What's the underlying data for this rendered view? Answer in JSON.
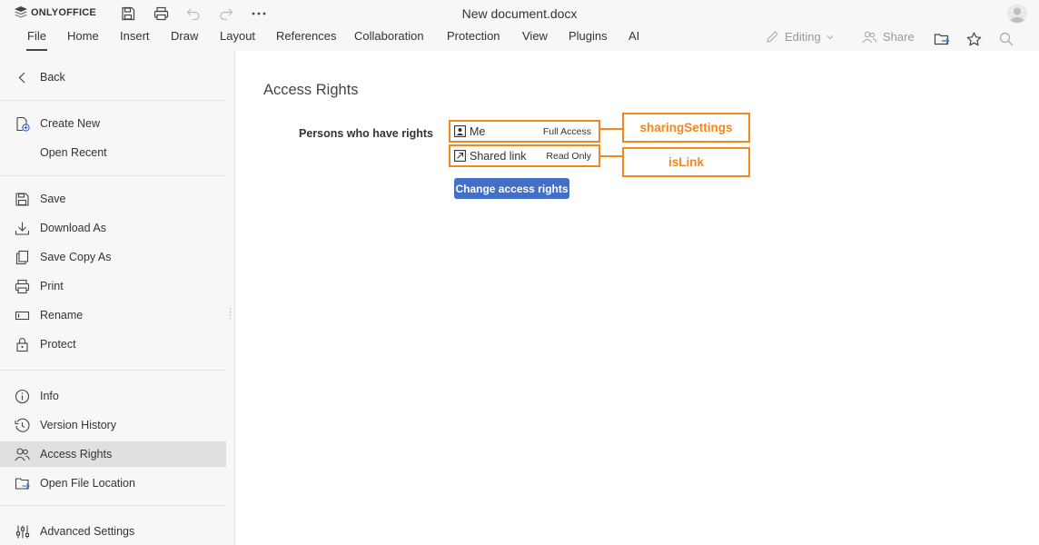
{
  "app": {
    "brand": "ONLYOFFICE",
    "document_title": "New document.docx"
  },
  "toolbar": {
    "quick_actions": [
      "save-icon",
      "print-icon",
      "undo-icon",
      "redo-icon",
      "more-icon"
    ],
    "tabs": [
      {
        "label": "File",
        "active": true
      },
      {
        "label": "Home"
      },
      {
        "label": "Insert"
      },
      {
        "label": "Draw"
      },
      {
        "label": "Layout"
      },
      {
        "label": "References"
      },
      {
        "label": "Collaboration"
      },
      {
        "label": "Protection"
      },
      {
        "label": "View"
      },
      {
        "label": "Plugins"
      },
      {
        "label": "AI"
      }
    ],
    "mode_label": "Editing",
    "share_label": "Share"
  },
  "sidebar": {
    "back_label": "Back",
    "items": [
      {
        "label": "Create New",
        "icon": "create-new-icon"
      },
      {
        "label": "Open Recent",
        "icon": ""
      },
      {
        "label": "Save",
        "icon": "save-icon"
      },
      {
        "label": "Download As",
        "icon": "download-icon"
      },
      {
        "label": "Save Copy As",
        "icon": "save-copy-icon"
      },
      {
        "label": "Print",
        "icon": "print-icon"
      },
      {
        "label": "Rename",
        "icon": "rename-icon"
      },
      {
        "label": "Protect",
        "icon": "lock-icon"
      },
      {
        "label": "Info",
        "icon": "info-icon"
      },
      {
        "label": "Version History",
        "icon": "history-icon"
      },
      {
        "label": "Access Rights",
        "icon": "users-icon",
        "selected": true
      },
      {
        "label": "Open File Location",
        "icon": "folder-icon"
      },
      {
        "label": "Advanced Settings",
        "icon": "sliders-icon"
      }
    ]
  },
  "access_rights": {
    "title": "Access Rights",
    "persons_label": "Persons who have rights",
    "rows": [
      {
        "name": "Me",
        "permission": "Full Access",
        "icon": "user-icon"
      },
      {
        "name": "Shared link",
        "permission": "Read Only",
        "icon": "link-icon"
      }
    ],
    "callouts": [
      "sharingSettings",
      "isLink"
    ],
    "change_button": "Change access rights"
  },
  "colors": {
    "accent_orange": "#f0871f",
    "button_blue": "#446fc6",
    "panel_bg": "#f7f7f7"
  }
}
